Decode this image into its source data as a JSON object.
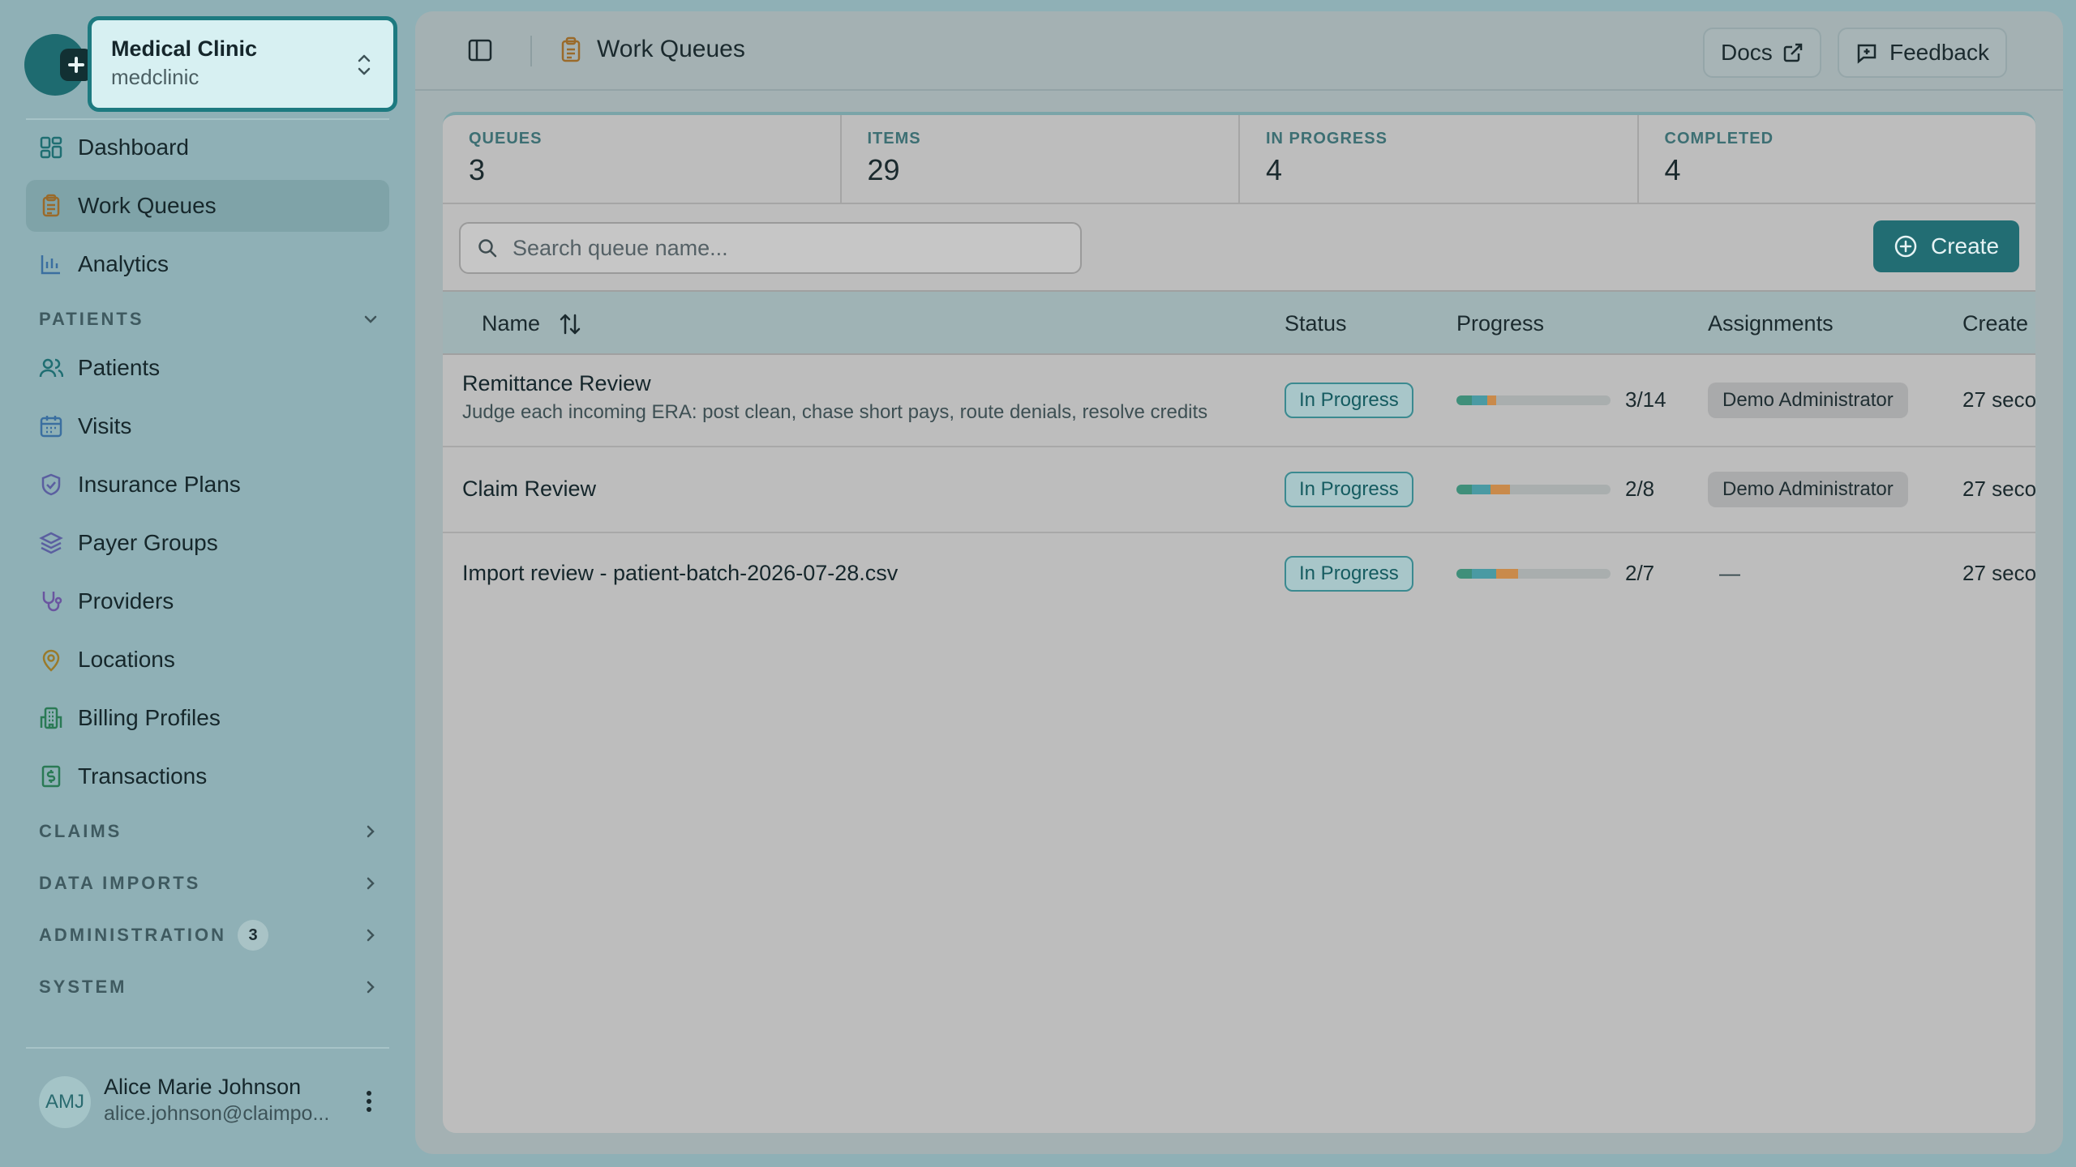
{
  "org": {
    "name": "Medical Clinic",
    "slug": "medclinic"
  },
  "nav": {
    "dashboard": "Dashboard",
    "work_queues": "Work Queues",
    "analytics": "Analytics",
    "patients_section": "PATIENTS",
    "patients": "Patients",
    "visits": "Visits",
    "insurance_plans": "Insurance Plans",
    "payer_groups": "Payer Groups",
    "providers": "Providers",
    "locations": "Locations",
    "billing_profiles": "Billing Profiles",
    "transactions": "Transactions",
    "claims_section": "CLAIMS",
    "data_imports_section": "DATA IMPORTS",
    "administration_section": "ADMINISTRATION",
    "administration_badge": "3",
    "system_section": "SYSTEM"
  },
  "user": {
    "initials": "AMJ",
    "name": "Alice Marie Johnson",
    "email": "alice.johnson@claimpo..."
  },
  "topbar": {
    "breadcrumb": "Work Queues",
    "docs_label": "Docs",
    "feedback_label": "Feedback"
  },
  "stats": [
    {
      "label": "QUEUES",
      "value": "3"
    },
    {
      "label": "ITEMS",
      "value": "29"
    },
    {
      "label": "IN PROGRESS",
      "value": "4"
    },
    {
      "label": "COMPLETED",
      "value": "4"
    }
  ],
  "search": {
    "placeholder": "Search queue name..."
  },
  "create_label": "Create",
  "table": {
    "columns": {
      "name": "Name",
      "status": "Status",
      "progress": "Progress",
      "assignments": "Assignments",
      "created": "Create"
    },
    "rows": [
      {
        "name": "Remittance Review",
        "description": "Judge each incoming ERA: post clean, chase short pays, route denials, resolve credits",
        "status": "In Progress",
        "progress": "3/14",
        "progress_fill": {
          "green": 0.1,
          "teal": 0.1,
          "orange": 0.06
        },
        "assignment": "Demo Administrator",
        "created": "27 seco"
      },
      {
        "name": "Claim Review",
        "description": "",
        "status": "In Progress",
        "progress": "2/8",
        "progress_fill": {
          "green": 0.1,
          "teal": 0.12,
          "orange": 0.13
        },
        "assignment": "Demo Administrator",
        "created": "27 seco"
      },
      {
        "name": "Import review - patient-batch-2026-07-28.csv",
        "description": "",
        "status": "In Progress",
        "progress": "2/7",
        "progress_fill": {
          "green": 0.1,
          "teal": 0.16,
          "orange": 0.14
        },
        "assignment": "—",
        "created": "27 seco"
      }
    ]
  },
  "colors": {
    "accent": "#226d73",
    "progress_green": "#3f8f7a",
    "progress_teal": "#4a9aa3",
    "progress_orange": "#c98a4b"
  }
}
